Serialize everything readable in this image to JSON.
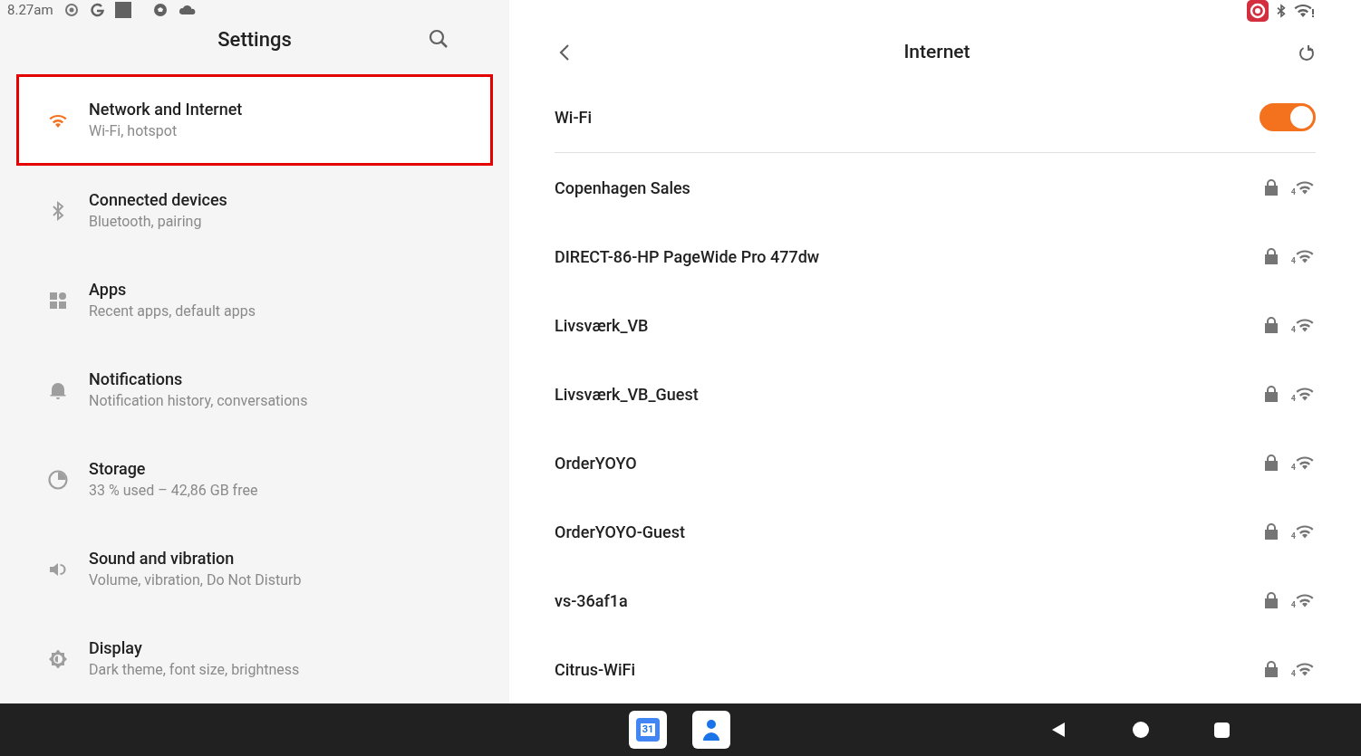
{
  "status_bar": {
    "time": "8.27am"
  },
  "settings": {
    "title": "Settings",
    "items": [
      {
        "kind": "wifi",
        "title": "Network and Internet",
        "subtitle": "Wi-Fi, hotspot",
        "selected": true
      },
      {
        "kind": "bluetooth",
        "title": "Connected devices",
        "subtitle": "Bluetooth, pairing",
        "selected": false
      },
      {
        "kind": "apps",
        "title": "Apps",
        "subtitle": "Recent apps, default apps",
        "selected": false
      },
      {
        "kind": "bell",
        "title": "Notifications",
        "subtitle": "Notification history, conversations",
        "selected": false
      },
      {
        "kind": "storage",
        "title": "Storage",
        "subtitle": "33 % used – 42,86 GB free",
        "selected": false
      },
      {
        "kind": "sound",
        "title": "Sound and vibration",
        "subtitle": "Volume, vibration, Do Not Disturb",
        "selected": false
      },
      {
        "kind": "display",
        "title": "Display",
        "subtitle": "Dark theme, font size, brightness",
        "selected": false
      }
    ]
  },
  "internet": {
    "title": "Internet",
    "wifi": {
      "label": "Wi-Fi",
      "on": true
    },
    "networks": [
      {
        "name": "Copenhagen Sales",
        "secured": true,
        "band": "4"
      },
      {
        "name": "DIRECT-86-HP PageWide Pro 477dw",
        "secured": true,
        "band": "4"
      },
      {
        "name": "Livsværk_VB",
        "secured": true,
        "band": "4"
      },
      {
        "name": "Livsværk_VB_Guest",
        "secured": true,
        "band": "4"
      },
      {
        "name": "OrderYOYO",
        "secured": true,
        "band": "4"
      },
      {
        "name": "OrderYOYO-Guest",
        "secured": true,
        "band": "4"
      },
      {
        "name": "vs-36af1a",
        "secured": true,
        "band": "4"
      },
      {
        "name": "Citrus-WiFi",
        "secured": true,
        "band": "4"
      }
    ]
  },
  "taskbar": {
    "calendar_day": "31"
  }
}
